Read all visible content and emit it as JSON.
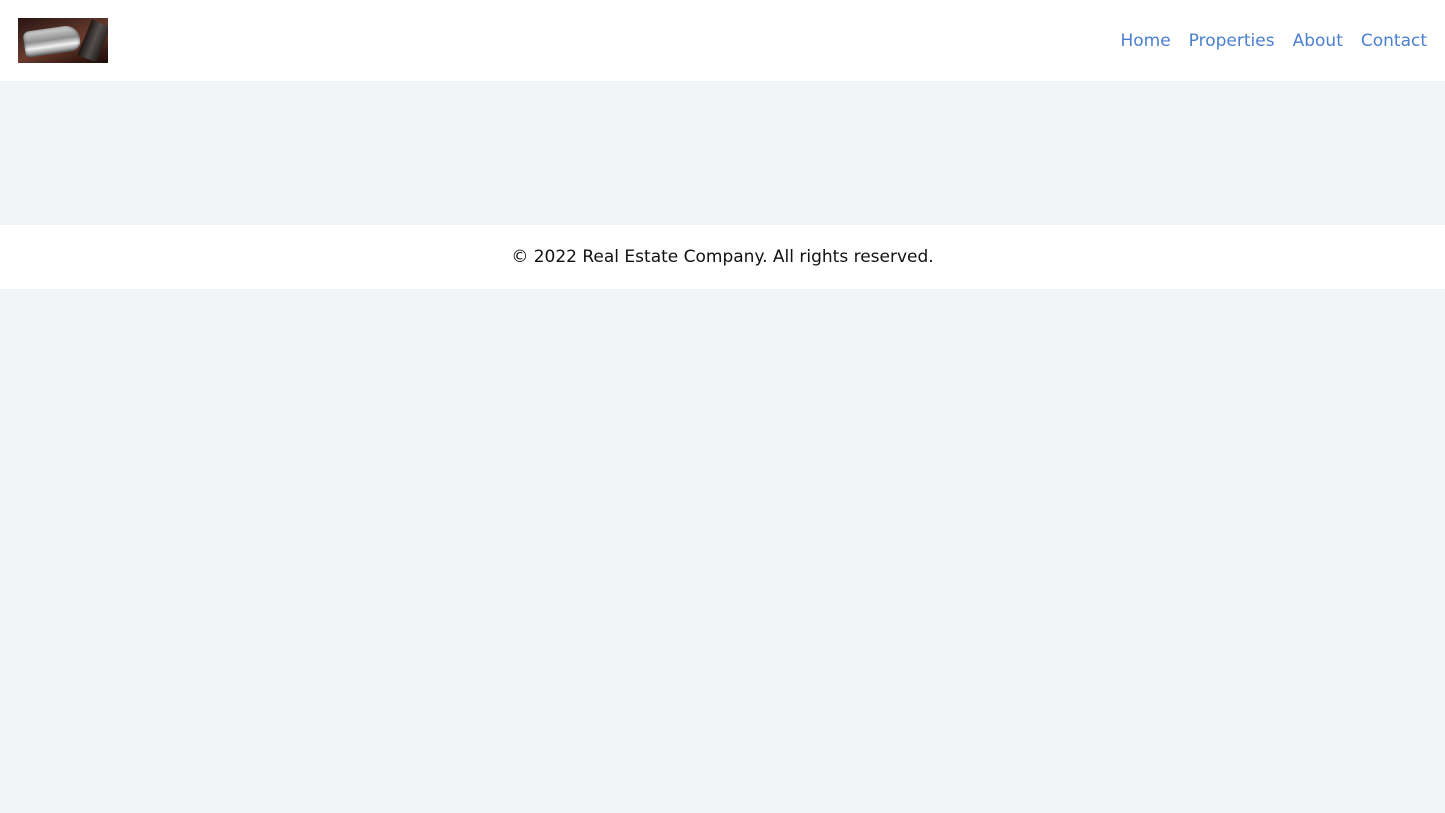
{
  "header": {
    "logo_alt": "logo",
    "nav": {
      "home_label": "Home",
      "properties_label": "Properties",
      "about_label": "About",
      "contact_label": "Contact"
    }
  },
  "footer": {
    "copyright": "© 2022 Real Estate Company. All rights reserved."
  },
  "colors": {
    "link": "#4a7fcf",
    "page_background": "#f2f3f7",
    "surface": "#ffffff"
  }
}
